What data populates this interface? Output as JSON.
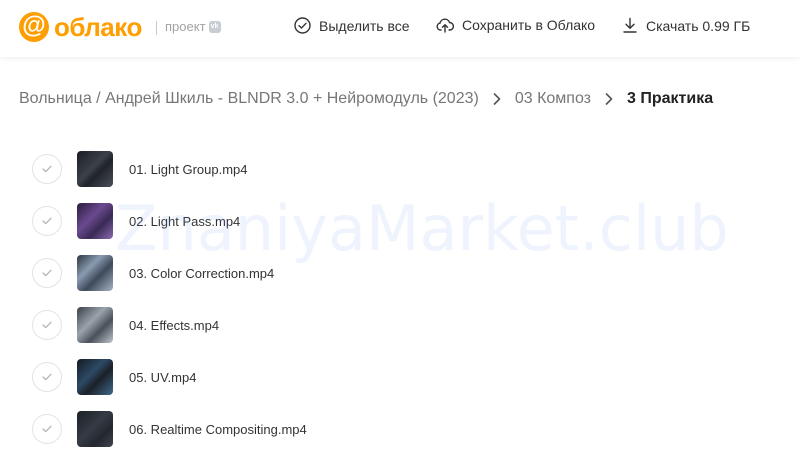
{
  "header": {
    "logo_mark": "@",
    "logo_text": "облако",
    "project_label": "проект",
    "project_badge": "vk",
    "actions": {
      "select_all": "Выделить все",
      "save_to_cloud": "Сохранить в Облако",
      "download": "Скачать 0.99 ГБ"
    }
  },
  "breadcrumb": {
    "root": "Вольница / Андрей Шкиль - BLNDR 3.0 + Нейромодуль (2023)",
    "level2": "03 Композ",
    "current": "3 Практика"
  },
  "files": [
    {
      "name": "01. Light Group.mp4"
    },
    {
      "name": "02. Light Pass.mp4"
    },
    {
      "name": "03. Color Correction.mp4"
    },
    {
      "name": "04. Effects.mp4"
    },
    {
      "name": "05. UV.mp4"
    },
    {
      "name": "06. Realtime Compositing.mp4"
    }
  ],
  "watermark": "ZnaniyaMarket.club",
  "colors": {
    "brand": "#ff9e00",
    "text": "#333333",
    "muted": "#777777"
  }
}
